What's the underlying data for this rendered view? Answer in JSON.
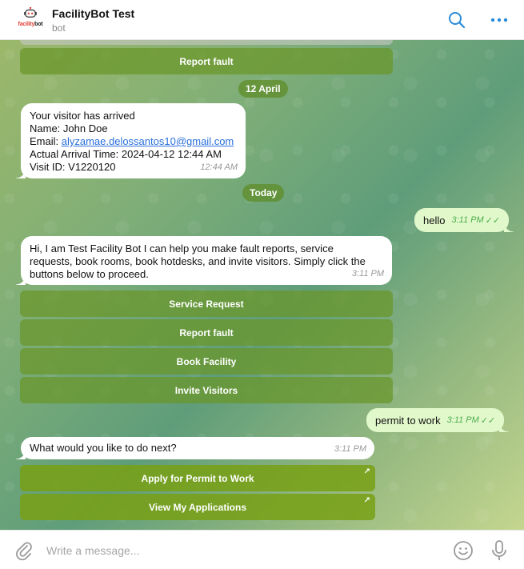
{
  "header": {
    "logo_text_prefix": "f",
    "logo_text_mid": "acility",
    "logo_text_suffix": "bot",
    "title": "FacilityBot Test",
    "subtitle": "bot"
  },
  "messages": {
    "top_button": "Report fault",
    "date1": "12 April",
    "visitor": {
      "line1": "Your visitor has arrived",
      "line2": "Name: John Doe",
      "email_label": "Email: ",
      "email": "alyzamae.delossantos10@gmail.com",
      "line4": "Actual Arrival Time: 2024-04-12 12:44 AM",
      "line5": "Visit ID: V1220120",
      "time": "12:44 AM"
    },
    "date2": "Today",
    "hello": {
      "text": "hello",
      "time": "3:11 PM"
    },
    "intro": {
      "line1": "Hi, I am Test Facility Bot I can help you make fault reports, service",
      "line2": "requests, book rooms, book hotdesks, and invite visitors. Simply click the",
      "line3": "buttons below to proceed.",
      "time": "3:11 PM"
    },
    "buttons": [
      "Service Request",
      "Report fault",
      "Book Facility",
      "Invite Visitors"
    ],
    "permit": {
      "text": "permit to work",
      "time": "3:11 PM"
    },
    "next": {
      "text": "What would you like to do next?",
      "time": "3:11 PM"
    },
    "link_buttons": [
      "Apply for Permit to Work",
      "View My Applications"
    ]
  },
  "composer": {
    "placeholder": "Write a message..."
  },
  "colors": {
    "accent": "#2a8bd8",
    "outgoing_bubble": "#e1f8cb",
    "read_check": "#4fae4e",
    "keyboard_button": "#6a9628"
  }
}
